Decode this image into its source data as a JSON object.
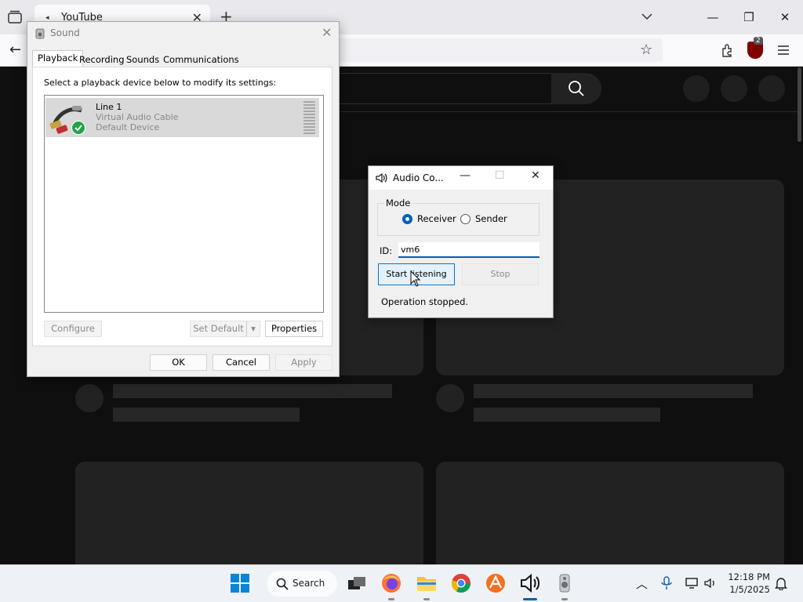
{
  "browser": {
    "tab_title": "YouTube",
    "new_tab": "+",
    "tab_close": "✕",
    "ublock_count": "2"
  },
  "sound": {
    "title": "Sound",
    "tabs": [
      "Playback",
      "Recording",
      "Sounds",
      "Communications"
    ],
    "instruction": "Select a playback device below to modify its settings:",
    "device": {
      "name": "Line 1",
      "type": "Virtual Audio Cable",
      "status": "Default Device"
    },
    "buttons": {
      "configure": "Configure",
      "set_default": "Set Default",
      "properties": "Properties",
      "ok": "OK",
      "cancel": "Cancel",
      "apply": "Apply"
    }
  },
  "audio_app": {
    "title": "Audio Co...",
    "mode_label": "Mode",
    "receiver_label": "Receiver",
    "sender_label": "Sender",
    "selected_mode": "Receiver",
    "id_label": "ID:",
    "id_value": "vm6",
    "start_button": "Start listening",
    "stop_button": "Stop",
    "status": "Operation stopped."
  },
  "taskbar": {
    "search_label": "Search",
    "time": "12:18 PM",
    "date": "1/5/2025"
  },
  "colors": {
    "accent": "#005fb8",
    "yt_background": "#0f0f0f",
    "check_green": "#20a34a"
  }
}
